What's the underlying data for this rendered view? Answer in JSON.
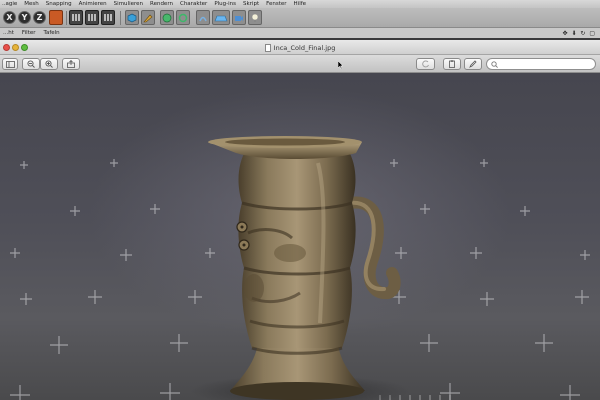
{
  "c4d": {
    "menu": [
      "..agie",
      "Mesh",
      "Snapping",
      "Animieren",
      "Simulieren",
      "Rendern",
      "Charakter",
      "Plug-ins",
      "Skript",
      "Fenster",
      "Hilfe"
    ],
    "layout_menu": [
      "...ht",
      "Filter",
      "Tafeln"
    ],
    "axis_buttons": [
      "X",
      "Y",
      "Z"
    ]
  },
  "preview": {
    "title": "Inca_Cold_Final.jpg",
    "search": {
      "value": "",
      "placeholder": ""
    }
  },
  "colors": {
    "close": "#e9504a",
    "minimize": "#e6b43a",
    "maximize": "#5fbe3f",
    "model_bronze": "#8a7a5c"
  }
}
